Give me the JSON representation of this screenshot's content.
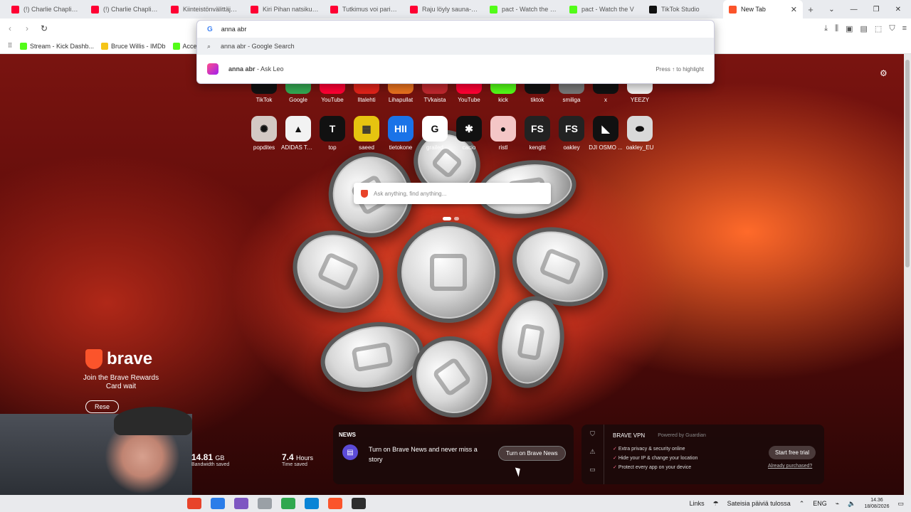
{
  "tabs": [
    {
      "label": "(!) Charlie Chaplin - S",
      "color": "#ff0033"
    },
    {
      "label": "(!) Charlie Chaplin M",
      "color": "#ff0033"
    },
    {
      "label": "Kiinteistönvälittäjätä",
      "color": "#ff0033"
    },
    {
      "label": "Kiri Pihan natsikulku",
      "color": "#ff0033"
    },
    {
      "label": "Tutkimus voi parittav",
      "color": "#ff0033"
    },
    {
      "label": "Raju löyly sauna-set",
      "color": "#ff0033"
    },
    {
      "label": "pact - Watch the VOD",
      "color": "#53fc18"
    },
    {
      "label": "pact - Watch the V",
      "color": "#53fc18"
    },
    {
      "label": "TikTok Studio",
      "color": "#111111"
    },
    {
      "label": "New Tab",
      "color": "#fb542b",
      "active": true
    }
  ],
  "bookmarks": [
    {
      "label": "Stream - Kick Dashb...",
      "color": "#53fc18"
    },
    {
      "label": "Bruce Willis - IMDb",
      "color": "#f5c518"
    },
    {
      "label": "Access",
      "color": "#53fc18"
    }
  ],
  "omnibox": {
    "input": "anna abr",
    "suggestion_search": "anna abr - Google Search",
    "suggestion_leo_query": "anna abr",
    "suggestion_leo_suffix": " - Ask Leo",
    "hint": "Press ↑ to highlight"
  },
  "shortcuts_row1": [
    {
      "name": "TikTok",
      "color": "#111111"
    },
    {
      "name": "Google",
      "color": "#34a853"
    },
    {
      "name": "YouTube",
      "color": "#ff0033"
    },
    {
      "name": "Iltalehti",
      "color": "#e2231a"
    },
    {
      "name": "Lihapullat",
      "color": "#e8721e"
    },
    {
      "name": "TVkaista",
      "color": "#c0282e"
    },
    {
      "name": "YouTube",
      "color": "#ff0033"
    },
    {
      "name": "kick",
      "color": "#53fc18"
    },
    {
      "name": "tiktok",
      "color": "#111111"
    },
    {
      "name": "smiliga",
      "color": "#777777"
    },
    {
      "name": "x",
      "color": "#111111"
    },
    {
      "name": "YEEZY",
      "color": "#f2f2f2"
    }
  ],
  "shortcuts_row2": [
    {
      "name": "popdites",
      "glyph": "✺",
      "color": "#d3c9c4"
    },
    {
      "name": "ADIDAS TA...",
      "glyph": "▲",
      "color": "#f2f2f2"
    },
    {
      "name": "top",
      "glyph": "T",
      "color": "#111111"
    },
    {
      "name": "saeed",
      "glyph": "▦",
      "color": "#e6c410"
    },
    {
      "name": "tietokone",
      "glyph": "HII",
      "color": "#1a73e8"
    },
    {
      "name": "grailed",
      "glyph": "G",
      "color": "#ffffff"
    },
    {
      "name": "cacio",
      "glyph": "✱",
      "color": "#111111"
    },
    {
      "name": "ristl",
      "glyph": "●",
      "color": "#f4c6c6"
    },
    {
      "name": "kenglit",
      "glyph": "FS",
      "color": "#222222"
    },
    {
      "name": "oakley",
      "glyph": "FS",
      "color": "#222222"
    },
    {
      "name": "DJI OSMO ...",
      "glyph": "◣",
      "color": "#111111"
    },
    {
      "name": "oakley_EU",
      "glyph": "⬬",
      "color": "#d9d9d9"
    }
  ],
  "search": {
    "placeholder": "Ask anything, find anything..."
  },
  "brave": {
    "logo": "brave",
    "rewards_text": "Join the Brave Rewards Card wait",
    "rewards_button": "Rese"
  },
  "stats": {
    "bandwidth_value": "14.81",
    "bandwidth_unit": "GB",
    "bandwidth_caption": "Bandwidth saved",
    "time_value": "7.4",
    "time_unit": "Hours",
    "time_caption": "Time saved"
  },
  "news": {
    "header": "NEWS",
    "text": "Turn on Brave News and never miss a story",
    "button": "Turn on Brave News"
  },
  "vpn": {
    "title": "BRAVE VPN",
    "powered": "Powered by Guardian",
    "features": [
      "Extra privacy & security online",
      "Hide your IP & change your location",
      "Protect every app on your device"
    ],
    "trial_button": "Start free trial",
    "purchased_link": "Already purchased?"
  },
  "taskbar": {
    "apps": [
      "#e8432a",
      "#2b7de9",
      "#7e57c2",
      "#9aa0a6",
      "#2fa84f",
      "#0a84d6",
      "#fb542b",
      "#2e2e2e"
    ],
    "links": "Links",
    "weather": "Sateisia päiviä tulossa",
    "lang": "ENG",
    "time": "14.36",
    "date": "18/08/2026"
  }
}
